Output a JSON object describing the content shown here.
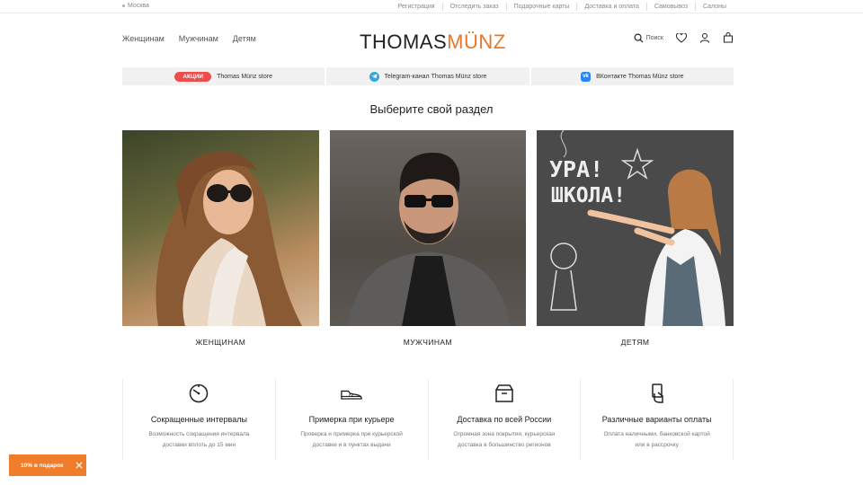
{
  "topbar": {
    "city": "Москва",
    "links": [
      "Регистрация",
      "Отследить заказ",
      "Подарочные карты",
      "Доставка и оплата",
      "Самовывоз",
      "Салоны"
    ]
  },
  "header": {
    "nav": [
      "Женщинам",
      "Мужчинам",
      "Детям"
    ],
    "logo_part1": "THOMAS",
    "logo_part2": "MÜNZ",
    "search_label": "Поиск"
  },
  "promo": {
    "badge": "АКЦИИ",
    "store_link": "Thomas Münz store",
    "telegram": "Telegram-канал Thomas Münz store",
    "vk": "ВКонтакте Thomas Münz store",
    "vk_icon_text": "vk"
  },
  "section_title": "Выберите свой раздел",
  "categories": [
    {
      "label": "ЖЕНЩИНАМ"
    },
    {
      "label": "МУЖЧИНАМ"
    },
    {
      "label": "ДЕТЯМ",
      "board_text_1": "УРА!",
      "board_text_2": "ШКОЛА!"
    }
  ],
  "features": [
    {
      "icon": "clock-icon",
      "title": "Сокращенные интервалы",
      "desc": "Возможность сокращения интервала доставки вплоть до 15 мин"
    },
    {
      "icon": "shoe-icon",
      "title": "Примерка при курьере",
      "desc": "Проверка и примерка при курьерской доставке и в пунктах выдачи"
    },
    {
      "icon": "box-icon",
      "title": "Доставка по всей России",
      "desc": "Огромная зона покрытия, курьерская доставка в большинство регионов"
    },
    {
      "icon": "card-hand-icon",
      "title": "Различные варианты оплаты",
      "desc": "Оплата наличными, банковской картой или в рассрочку"
    }
  ],
  "gift": {
    "label": "10% в подарок"
  },
  "colors": {
    "accent": "#ef7d2b",
    "badge": "#ef4c4c",
    "telegram": "#34a7dc",
    "vk": "#2787f5"
  }
}
